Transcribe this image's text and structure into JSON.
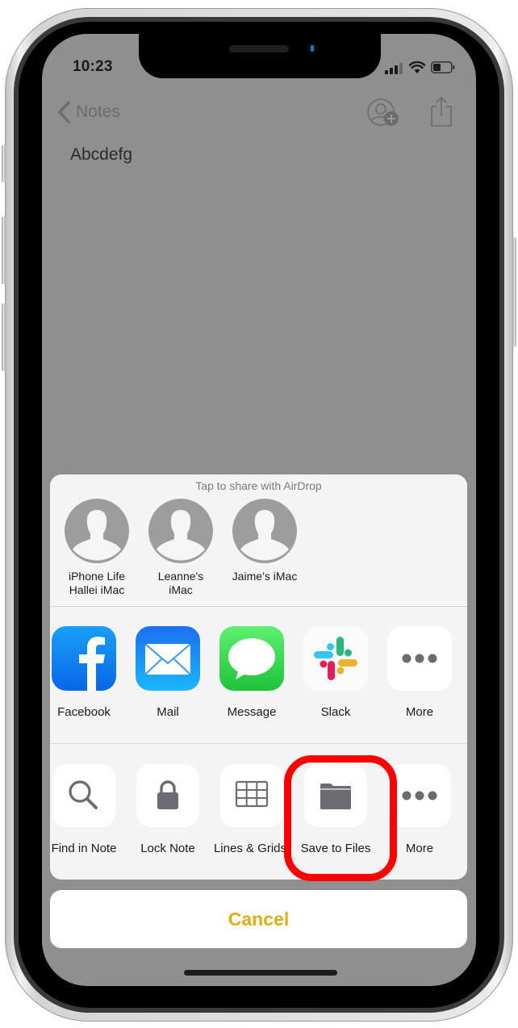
{
  "status_bar": {
    "time": "10:23",
    "icons": [
      "cellular-signal-icon",
      "wifi-icon",
      "battery-icon"
    ]
  },
  "nav": {
    "back_label": "Notes",
    "back_icon": "chevron-left-icon",
    "right_icons": [
      "add-person-icon",
      "share-icon"
    ]
  },
  "note": {
    "text": "Abcdefg"
  },
  "share_sheet": {
    "airdrop_title": "Tap to share with AirDrop",
    "airdrop_targets": [
      {
        "line1": "iPhone Life",
        "line2": "Hallei iMac"
      },
      {
        "line1": "Leanne's",
        "line2": "iMac"
      },
      {
        "line1": "Jaime’s iMac",
        "line2": ""
      }
    ],
    "apps": [
      {
        "label": "Facebook",
        "icon": "facebook-icon"
      },
      {
        "label": "Mail",
        "icon": "mail-icon"
      },
      {
        "label": "Message",
        "icon": "messages-icon"
      },
      {
        "label": "Slack",
        "icon": "slack-icon"
      },
      {
        "label": "More",
        "icon": "more-icon"
      }
    ],
    "actions": [
      {
        "label": "Find in Note",
        "icon": "magnifier-icon"
      },
      {
        "label": "Lock Note",
        "icon": "lock-icon"
      },
      {
        "label": "Lines & Grids",
        "icon": "grid-icon"
      },
      {
        "label": "Save to Files",
        "icon": "folder-icon",
        "highlighted": true
      },
      {
        "label": "More",
        "icon": "more-icon"
      }
    ],
    "cancel_label": "Cancel"
  },
  "colors": {
    "accent": "#e0ac16",
    "highlight": "#ff0000",
    "sheet_bg": "#f4f4f4",
    "dimmed_bg": "#8f8f8f"
  }
}
